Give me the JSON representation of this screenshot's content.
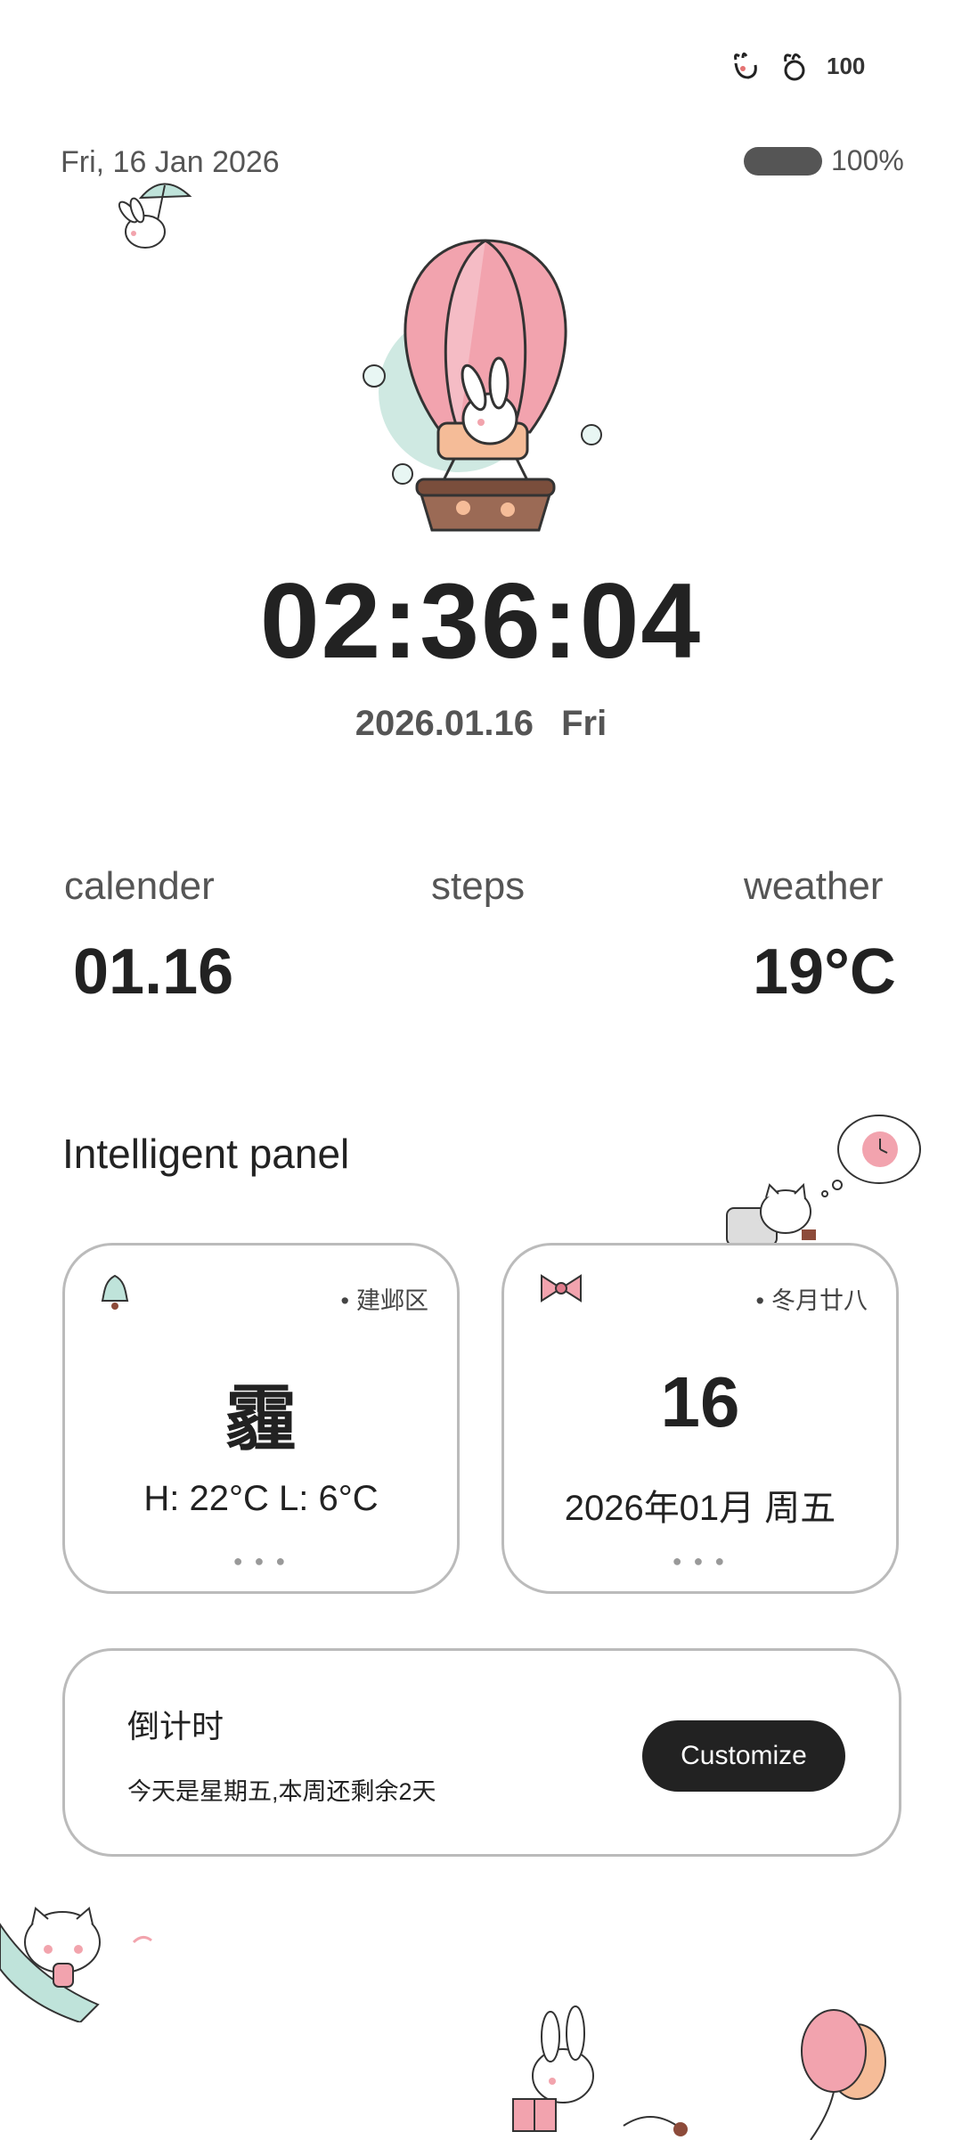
{
  "status_bar": {
    "signal_label": "100",
    "icons": [
      "bunny-paw-icon",
      "bunny-head-icon",
      "battery-icon"
    ]
  },
  "lock": {
    "top_date": "Fri, 16 Jan 2026",
    "battery_percent": "100%",
    "battery_level": 1.0,
    "clock": "02:36:04",
    "date_line": "2026.01.16 Fri"
  },
  "stats": {
    "calendar": {
      "label": "calender",
      "value": "01.16"
    },
    "steps": {
      "label": "steps",
      "value": ""
    },
    "weather": {
      "label": "weather",
      "value": "19°C"
    }
  },
  "panel": {
    "title": "Intelligent panel",
    "weather_card": {
      "location": "建邺区",
      "condition": "霾",
      "range": "H: 22°C  L: 6°C",
      "icon": "bell-icon"
    },
    "calendar_card": {
      "lunar": "冬月廿八",
      "day": "16",
      "month_line": "2026年01月 周五",
      "icon": "bow-icon"
    },
    "countdown": {
      "title": "倒计时",
      "message": "今天是星期五,本周还剩余2天",
      "button": "Customize"
    }
  },
  "colors": {
    "accent": "#222222",
    "pink": "#f0a7ad",
    "mint": "#cfe9e2",
    "border": "#bbbbbb"
  }
}
